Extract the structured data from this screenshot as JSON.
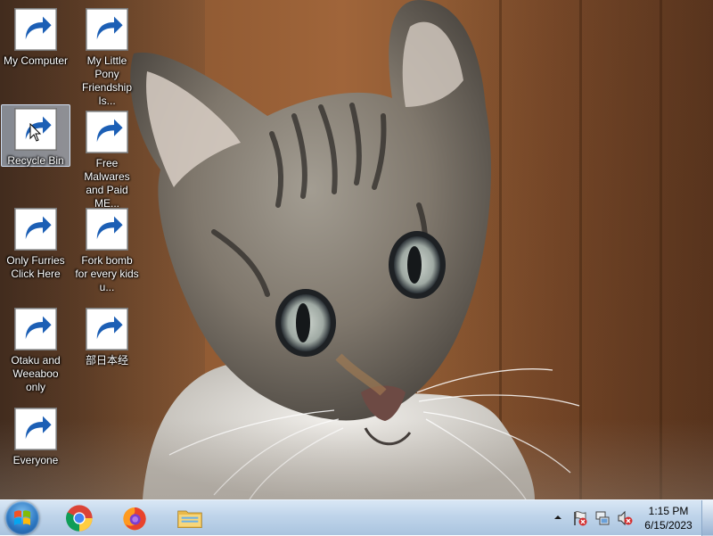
{
  "desktop": {
    "icons": [
      {
        "label": "My Computer"
      },
      {
        "label": "My Little Pony Friendship Is..."
      },
      {
        "label": "Recycle Bin"
      },
      {
        "label": "Free Malwares and Paid ME..."
      },
      {
        "label": "Only Furries Click Here"
      },
      {
        "label": "Fork bomb for every kids u..."
      },
      {
        "label": "Otaku and Weeaboo only"
      },
      {
        "label": "部日本经"
      },
      {
        "label": "Everyone"
      }
    ]
  },
  "taskbar": {
    "pinned": [
      "chrome-icon",
      "firefox-icon",
      "file-explorer-icon"
    ],
    "tray": [
      "show-hidden-icons-arrow",
      "action-center-flag-icon",
      "network-icon",
      "volume-muted-icon"
    ],
    "clock": {
      "time": "1:15 PM",
      "date": "6/15/2023"
    }
  }
}
